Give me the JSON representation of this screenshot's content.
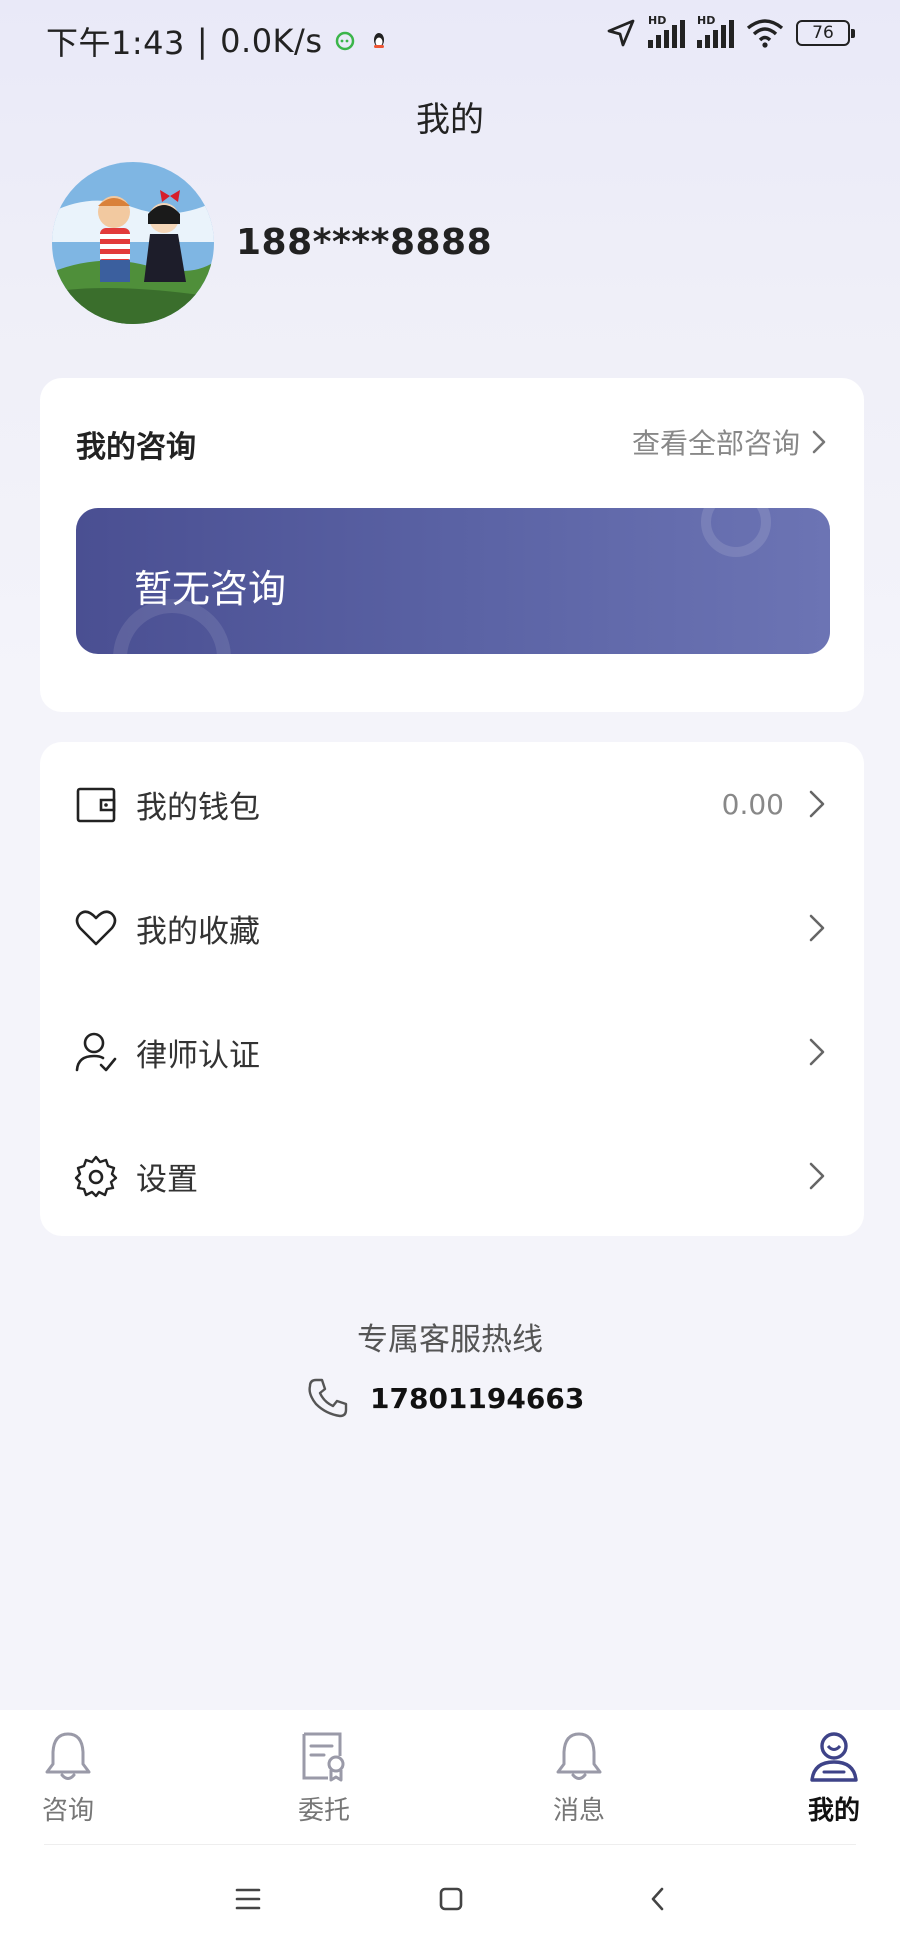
{
  "status_bar": {
    "time": "下午1:43",
    "speed": "0.0K/s",
    "signal_label": "HD",
    "battery": "76"
  },
  "page": {
    "title": "我的"
  },
  "profile": {
    "phone": "188****8888"
  },
  "consultations": {
    "title": "我的咨询",
    "view_all": "查看全部咨询",
    "empty_text": "暂无咨询"
  },
  "menu": {
    "wallet": {
      "label": "我的钱包",
      "value": "0.00",
      "icon": "wallet-icon"
    },
    "favorites": {
      "label": "我的收藏",
      "icon": "heart-icon"
    },
    "lawyer_cert": {
      "label": "律师认证",
      "icon": "user-check-icon"
    },
    "settings": {
      "label": "设置",
      "icon": "gear-icon"
    }
  },
  "hotline": {
    "title": "专属客服热线",
    "number": "17801194663"
  },
  "tabbar": {
    "tabs": [
      {
        "label": "咨询",
        "icon": "bell-icon"
      },
      {
        "label": "委托",
        "icon": "document-icon"
      },
      {
        "label": "消息",
        "icon": "bell-icon"
      },
      {
        "label": "我的",
        "icon": "person-icon",
        "active": true
      }
    ]
  },
  "colors": {
    "accent": "#4a4f92",
    "banner_end": "#6c74b4",
    "background": "#f4f4fa"
  }
}
